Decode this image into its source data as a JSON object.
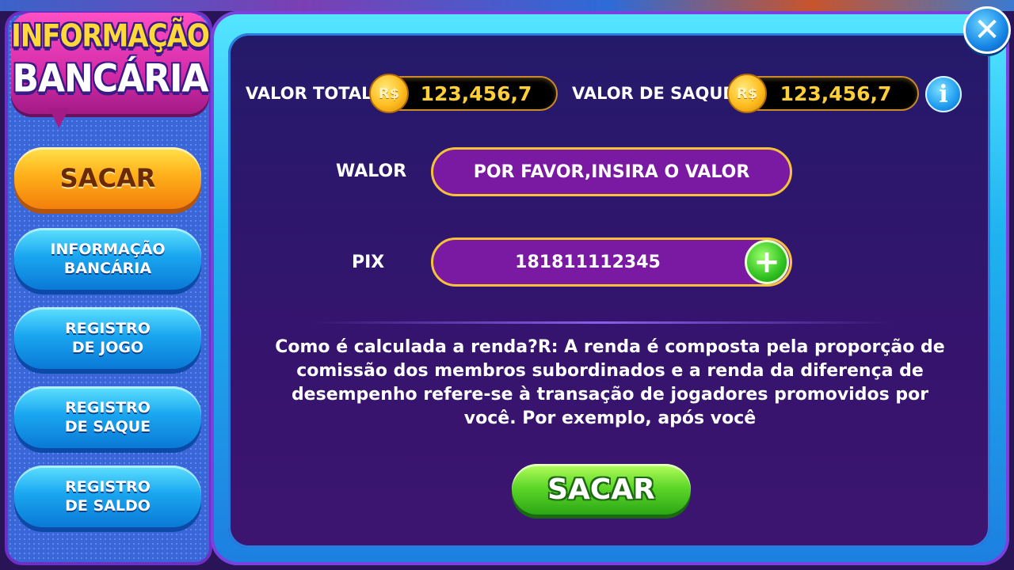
{
  "sidebar": {
    "title_line1": "INFORMAÇÃO",
    "title_line2": "BANCÁRIA",
    "items": [
      {
        "label": "SACAR"
      },
      {
        "label_line1": "INFORMAÇÃO",
        "label_line2": "BANCÁRIA"
      },
      {
        "label_line1": "REGISTRO",
        "label_line2": "DE JOGO"
      },
      {
        "label_line1": "REGISTRO",
        "label_line2": "DE SAQUE"
      },
      {
        "label_line1": "REGISTRO",
        "label_line2": "DE SALDO"
      }
    ]
  },
  "balances": {
    "total_label": "VALOR TOTAL",
    "total_value": "123,456,7",
    "withdraw_label": "VALOR DE SAQUE",
    "withdraw_value": "123,456,7",
    "currency_symbol": "R$"
  },
  "form": {
    "amount_label": "WALOR",
    "amount_placeholder": "POR FAVOR,INSIRA O VALOR",
    "pix_label": "PIX",
    "pix_value": "181811112345"
  },
  "description": "Como é calculada a renda?R: A renda é composta pela proporção de comissão dos membros subordinados e a renda da diferença de desempenho refere-se à transação de jogadores promovidos por você. Por exemplo, após você",
  "actions": {
    "submit_label": "SACAR",
    "close_glyph": "✕",
    "info_glyph": "i",
    "plus_glyph": "+"
  },
  "colors": {
    "panel_bg": "#2a1a6a",
    "accent_gold": "#f5c23a",
    "input_bg": "#7a1aa3",
    "sidebar_blue": "#1aa7f0",
    "active_orange": "#ffb01a",
    "submit_green": "#5fd82a"
  }
}
